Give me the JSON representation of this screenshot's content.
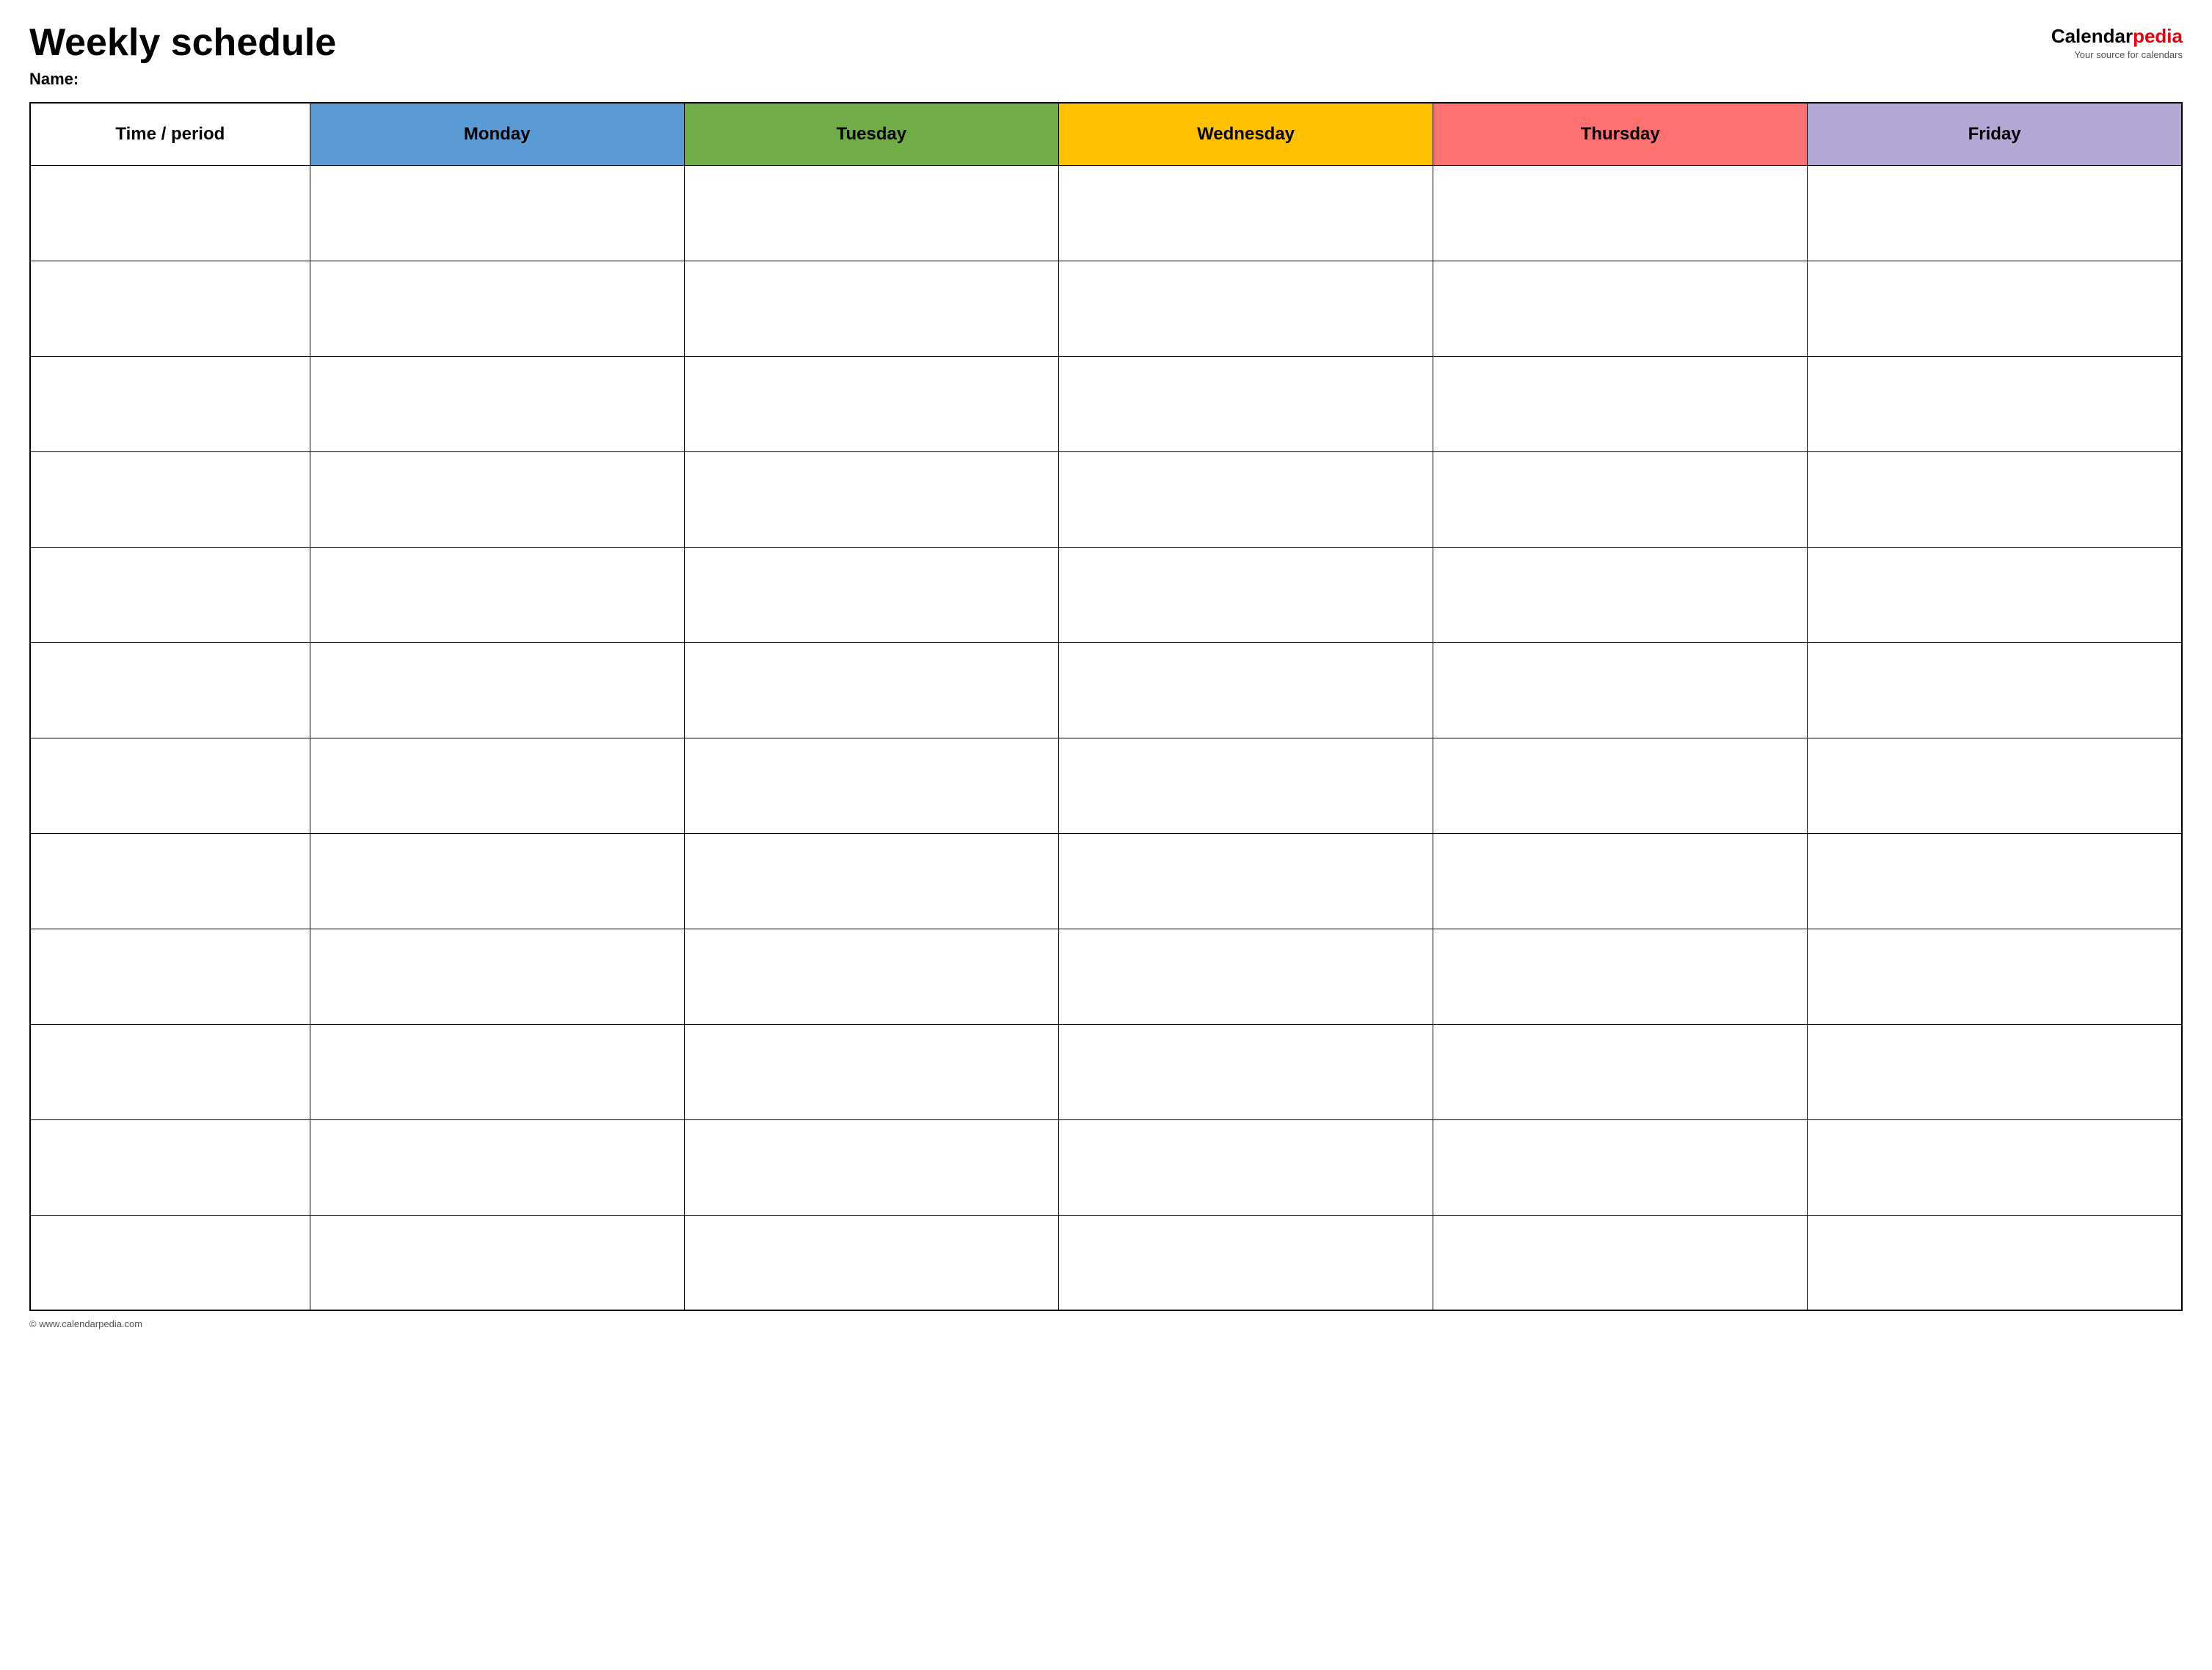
{
  "header": {
    "title": "Weekly schedule",
    "name_label": "Name:",
    "logo_calendar": "Calendar",
    "logo_pedia": "pedia",
    "logo_tagline": "Your source for calendars"
  },
  "table": {
    "columns": [
      {
        "key": "time",
        "label": "Time / period",
        "color": "#ffffff"
      },
      {
        "key": "monday",
        "label": "Monday",
        "color": "#5b9bd5"
      },
      {
        "key": "tuesday",
        "label": "Tuesday",
        "color": "#70ad47"
      },
      {
        "key": "wednesday",
        "label": "Wednesday",
        "color": "#ffc000"
      },
      {
        "key": "thursday",
        "label": "Thursday",
        "color": "#ff7070"
      },
      {
        "key": "friday",
        "label": "Friday",
        "color": "#b4a7d6"
      }
    ],
    "row_count": 12
  },
  "footer": {
    "url": "© www.calendarpedia.com"
  }
}
